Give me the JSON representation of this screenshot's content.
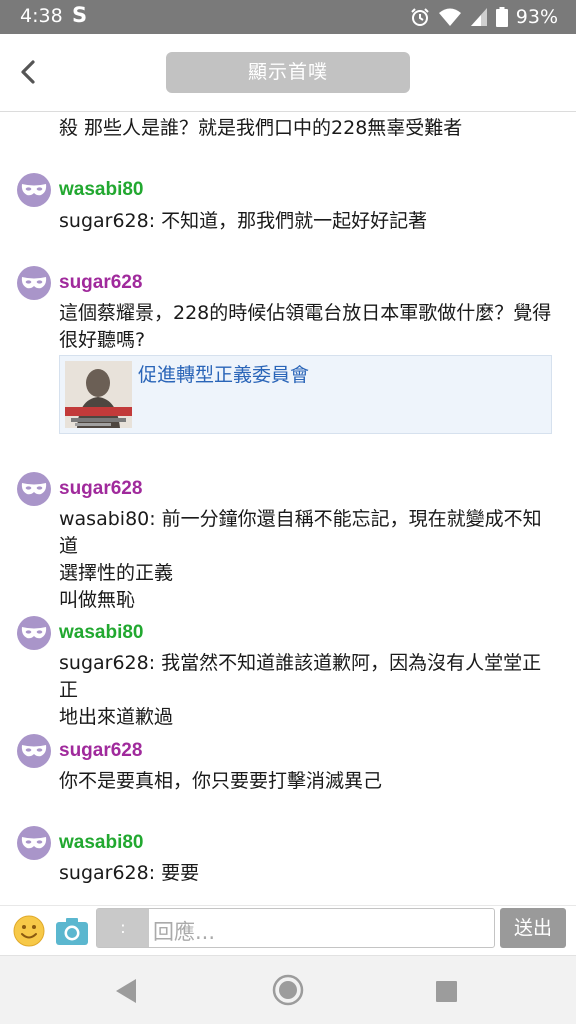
{
  "status_bar": {
    "time": "4:38",
    "app_letter": "S",
    "battery": "93%"
  },
  "header": {
    "home_label": "顯示首噗"
  },
  "messages": [
    {
      "text": "殺 那些人是誰？就是我們口中的228無辜受難者"
    },
    {
      "user": "wasabi80",
      "text": "sugar628: 不知道，那我們就一起好好記著"
    },
    {
      "user": "sugar628",
      "lines": [
        "這個蔡耀景，228的時候佔領電台放日本軍歌做什麼？覺得",
        "很好聽嗎?"
      ],
      "link_title": "促進轉型正義委員會"
    },
    {
      "user": "sugar628",
      "lines": [
        "wasabi80: 前一分鐘你還自稱不能忘記，現在就變成不知道",
        "選擇性的正義",
        "叫做無恥"
      ]
    },
    {
      "user": "wasabi80",
      "lines": [
        "sugar628: 我當然不知道誰該道歉阿，因為沒有人堂堂正正",
        "地出來道歉過"
      ]
    },
    {
      "user": "sugar628",
      "text": "你不是要真相，你只要要打擊消滅異己"
    },
    {
      "user": "wasabi80",
      "text": "sugar628: 要要"
    }
  ],
  "input": {
    "prefix": ":",
    "placeholder": "回應...",
    "send_label": "送出"
  },
  "colors": {
    "green_user": "#22a830",
    "purple_user": "#a02a9c",
    "avatar": "#a995c9",
    "link": "#2a65b8"
  }
}
